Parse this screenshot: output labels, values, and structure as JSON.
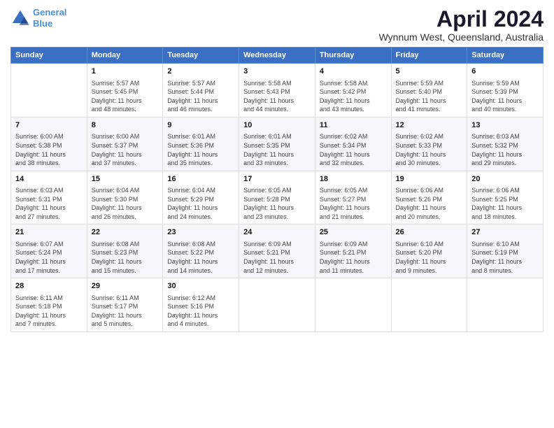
{
  "header": {
    "logo_line1": "General",
    "logo_line2": "Blue",
    "month": "April 2024",
    "location": "Wynnum West, Queensland, Australia"
  },
  "weekdays": [
    "Sunday",
    "Monday",
    "Tuesday",
    "Wednesday",
    "Thursday",
    "Friday",
    "Saturday"
  ],
  "weeks": [
    [
      {
        "day": "",
        "info": ""
      },
      {
        "day": "1",
        "info": "Sunrise: 5:57 AM\nSunset: 5:45 PM\nDaylight: 11 hours\nand 48 minutes."
      },
      {
        "day": "2",
        "info": "Sunrise: 5:57 AM\nSunset: 5:44 PM\nDaylight: 11 hours\nand 46 minutes."
      },
      {
        "day": "3",
        "info": "Sunrise: 5:58 AM\nSunset: 5:43 PM\nDaylight: 11 hours\nand 44 minutes."
      },
      {
        "day": "4",
        "info": "Sunrise: 5:58 AM\nSunset: 5:42 PM\nDaylight: 11 hours\nand 43 minutes."
      },
      {
        "day": "5",
        "info": "Sunrise: 5:59 AM\nSunset: 5:40 PM\nDaylight: 11 hours\nand 41 minutes."
      },
      {
        "day": "6",
        "info": "Sunrise: 5:59 AM\nSunset: 5:39 PM\nDaylight: 11 hours\nand 40 minutes."
      }
    ],
    [
      {
        "day": "7",
        "info": "Sunrise: 6:00 AM\nSunset: 5:38 PM\nDaylight: 11 hours\nand 38 minutes."
      },
      {
        "day": "8",
        "info": "Sunrise: 6:00 AM\nSunset: 5:37 PM\nDaylight: 11 hours\nand 37 minutes."
      },
      {
        "day": "9",
        "info": "Sunrise: 6:01 AM\nSunset: 5:36 PM\nDaylight: 11 hours\nand 35 minutes."
      },
      {
        "day": "10",
        "info": "Sunrise: 6:01 AM\nSunset: 5:35 PM\nDaylight: 11 hours\nand 33 minutes."
      },
      {
        "day": "11",
        "info": "Sunrise: 6:02 AM\nSunset: 5:34 PM\nDaylight: 11 hours\nand 32 minutes."
      },
      {
        "day": "12",
        "info": "Sunrise: 6:02 AM\nSunset: 5:33 PM\nDaylight: 11 hours\nand 30 minutes."
      },
      {
        "day": "13",
        "info": "Sunrise: 6:03 AM\nSunset: 5:32 PM\nDaylight: 11 hours\nand 29 minutes."
      }
    ],
    [
      {
        "day": "14",
        "info": "Sunrise: 6:03 AM\nSunset: 5:31 PM\nDaylight: 11 hours\nand 27 minutes."
      },
      {
        "day": "15",
        "info": "Sunrise: 6:04 AM\nSunset: 5:30 PM\nDaylight: 11 hours\nand 26 minutes."
      },
      {
        "day": "16",
        "info": "Sunrise: 6:04 AM\nSunset: 5:29 PM\nDaylight: 11 hours\nand 24 minutes."
      },
      {
        "day": "17",
        "info": "Sunrise: 6:05 AM\nSunset: 5:28 PM\nDaylight: 11 hours\nand 23 minutes."
      },
      {
        "day": "18",
        "info": "Sunrise: 6:05 AM\nSunset: 5:27 PM\nDaylight: 11 hours\nand 21 minutes."
      },
      {
        "day": "19",
        "info": "Sunrise: 6:06 AM\nSunset: 5:26 PM\nDaylight: 11 hours\nand 20 minutes."
      },
      {
        "day": "20",
        "info": "Sunrise: 6:06 AM\nSunset: 5:25 PM\nDaylight: 11 hours\nand 18 minutes."
      }
    ],
    [
      {
        "day": "21",
        "info": "Sunrise: 6:07 AM\nSunset: 5:24 PM\nDaylight: 11 hours\nand 17 minutes."
      },
      {
        "day": "22",
        "info": "Sunrise: 6:08 AM\nSunset: 5:23 PM\nDaylight: 11 hours\nand 15 minutes."
      },
      {
        "day": "23",
        "info": "Sunrise: 6:08 AM\nSunset: 5:22 PM\nDaylight: 11 hours\nand 14 minutes."
      },
      {
        "day": "24",
        "info": "Sunrise: 6:09 AM\nSunset: 5:21 PM\nDaylight: 11 hours\nand 12 minutes."
      },
      {
        "day": "25",
        "info": "Sunrise: 6:09 AM\nSunset: 5:21 PM\nDaylight: 11 hours\nand 11 minutes."
      },
      {
        "day": "26",
        "info": "Sunrise: 6:10 AM\nSunset: 5:20 PM\nDaylight: 11 hours\nand 9 minutes."
      },
      {
        "day": "27",
        "info": "Sunrise: 6:10 AM\nSunset: 5:19 PM\nDaylight: 11 hours\nand 8 minutes."
      }
    ],
    [
      {
        "day": "28",
        "info": "Sunrise: 6:11 AM\nSunset: 5:18 PM\nDaylight: 11 hours\nand 7 minutes."
      },
      {
        "day": "29",
        "info": "Sunrise: 6:11 AM\nSunset: 5:17 PM\nDaylight: 11 hours\nand 5 minutes."
      },
      {
        "day": "30",
        "info": "Sunrise: 6:12 AM\nSunset: 5:16 PM\nDaylight: 11 hours\nand 4 minutes."
      },
      {
        "day": "",
        "info": ""
      },
      {
        "day": "",
        "info": ""
      },
      {
        "day": "",
        "info": ""
      },
      {
        "day": "",
        "info": ""
      }
    ]
  ]
}
